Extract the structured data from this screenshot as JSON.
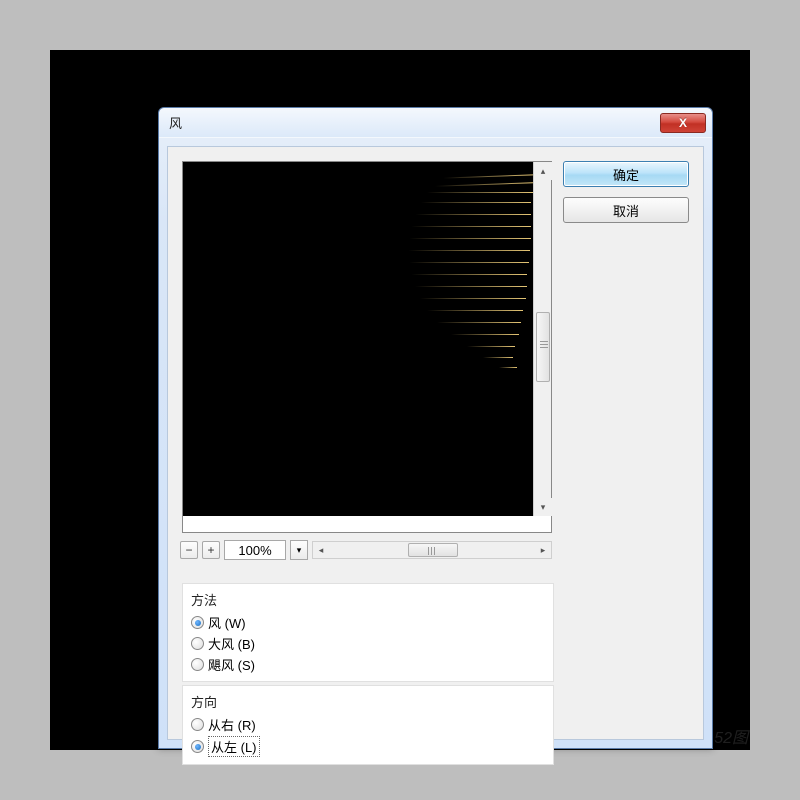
{
  "dialog": {
    "title": "风",
    "close_symbol": "X"
  },
  "buttons": {
    "ok": "确定",
    "cancel": "取消"
  },
  "zoom": {
    "minus": "−",
    "plus": "+",
    "value": "100%",
    "dropdown": "▾"
  },
  "method": {
    "title": "方法",
    "options": [
      {
        "label": "风 (W)",
        "checked": true
      },
      {
        "label": "大风 (B)",
        "checked": false
      },
      {
        "label": "飓风 (S)",
        "checked": false
      }
    ]
  },
  "direction": {
    "title": "方向",
    "options": [
      {
        "label": "从右 (R)",
        "checked": false
      },
      {
        "label": "从左 (L)",
        "checked": true,
        "focused": true
      }
    ]
  }
}
